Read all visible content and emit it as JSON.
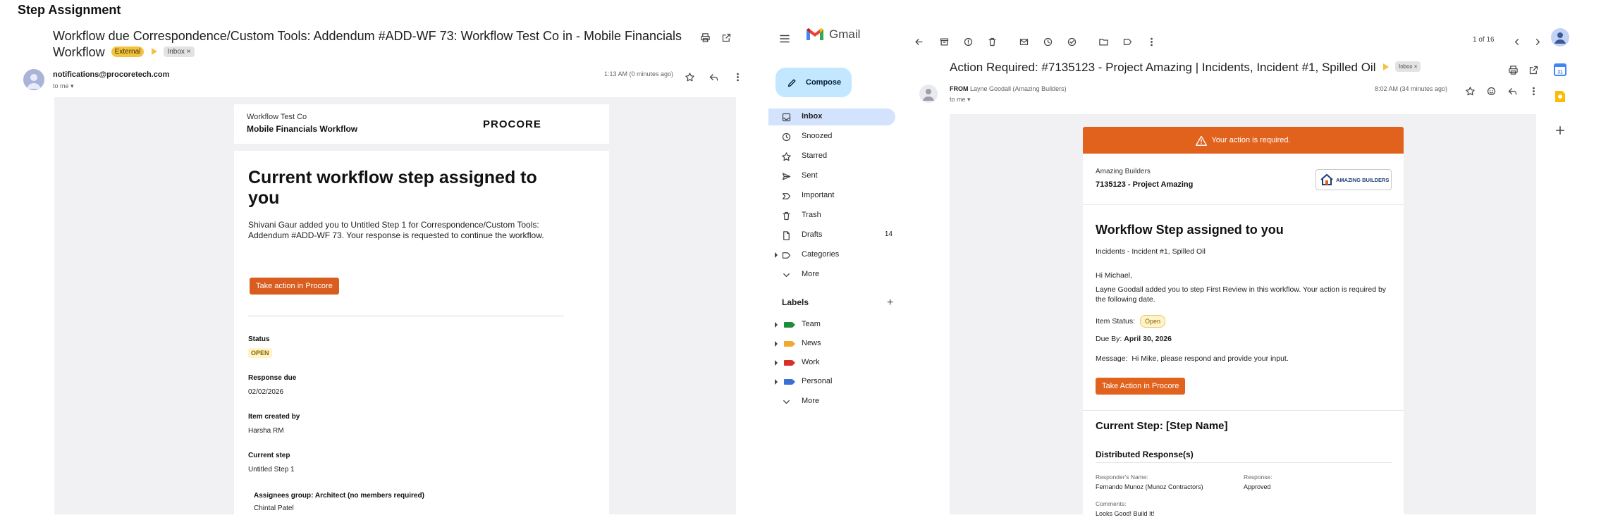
{
  "page_title": "Step Assignment",
  "left": {
    "subject": "Workflow due Correspondence/Custom Tools: Addendum #ADD-WF 73: Workflow Test Co in - Mobile Financials Workflow",
    "chip_external": "External",
    "chip_inbox": "Inbox ×",
    "sender": "notifications@procoretech.com",
    "to_me": "to me ▾",
    "time": "1:13 AM (0 minutes ago)",
    "header": {
      "company": "Workflow Test Co",
      "workflow": "Mobile Financials Workflow",
      "logo": "PROCORE"
    },
    "heading": "Current workflow step assigned to you",
    "paragraph": "Shivani Gaur added you to Untitled Step 1 for Correspondence/Custom Tools: Addendum #ADD-WF 73. Your response is requested to continue the workflow.",
    "action_button": "Take action in Procore",
    "status_label": "Status",
    "status_value": "OPEN",
    "response_due_label": "Response due",
    "response_due_value": "02/02/2026",
    "created_by_label": "Item created by",
    "created_by_value": "Harsha RM",
    "current_step_label": "Current step",
    "current_step_value": "Untitled Step 1",
    "assignees_label": "Assignees group: Architect (no members required)",
    "assignee_1": "Chintal Patel"
  },
  "gmail": {
    "logo_text": "Gmail",
    "compose": "Compose",
    "nav": [
      {
        "label": "Inbox",
        "count": "",
        "icon": "inbox-icon"
      },
      {
        "label": "Snoozed",
        "count": "",
        "icon": "clock-icon"
      },
      {
        "label": "Starred",
        "count": "",
        "icon": "star-icon"
      },
      {
        "label": "Sent",
        "count": "",
        "icon": "send-icon"
      },
      {
        "label": "Important",
        "count": "",
        "icon": "important-icon"
      },
      {
        "label": "Trash",
        "count": "",
        "icon": "trash-icon"
      },
      {
        "label": "Drafts",
        "count": "14",
        "icon": "draft-icon"
      },
      {
        "label": "Categories",
        "count": "",
        "icon": "label-icon"
      },
      {
        "label": "More",
        "count": "",
        "icon": "chevron-down-icon"
      }
    ],
    "labels_heading": "Labels",
    "labels_add": "+",
    "labels": [
      {
        "label": "Team",
        "color": "#1e8e3e"
      },
      {
        "label": "News",
        "color": "#f0a830"
      },
      {
        "label": "Work",
        "color": "#d93025"
      },
      {
        "label": "Personal",
        "color": "#3b6fd6"
      }
    ],
    "labels_more": "More",
    "pager": "1 of 16",
    "subject": "Action Required: #7135123 - Project Amazing  |  Incidents, Incident #1, Spilled Oil",
    "chip_inbox": "Inbox ×",
    "from_prefix": "FROM",
    "from": "Layne Goodall (Amazing Builders)",
    "to_me": "to me ▾",
    "time": "8:02 AM (34 minutes ago)",
    "email": {
      "banner": "Your action is required.",
      "company": "Amazing Builders",
      "project": "7135123 - Project Amazing",
      "logo": "AMAZING BUILDERS",
      "heading": "Workflow Step assigned to you",
      "subheading": "Incidents - Incident #1, Spilled Oil",
      "greeting": "Hi Michael,",
      "body": "Layne Goodall added you to step First Review in this workflow. Your action is required by the following date.",
      "item_status_label": "Item Status:",
      "item_status_value": "Open",
      "due_label": "Due By:",
      "due_value": "April 30, 2026",
      "message_label": "Message:",
      "message_value": "Hi Mike, please respond and provide your input.",
      "action_button": "Take Action in Procore",
      "current_step": "Current Step: [Step Name]",
      "distributed": "Distributed Response(s)",
      "responder_label": "Responder's Name:",
      "responder_value": "Fernando Munoz (Munoz Contractors)",
      "response_label": "Response:",
      "response_value": "Approved",
      "comments_label": "Comments:",
      "comments_value": "Looks Good! Build It!"
    }
  }
}
